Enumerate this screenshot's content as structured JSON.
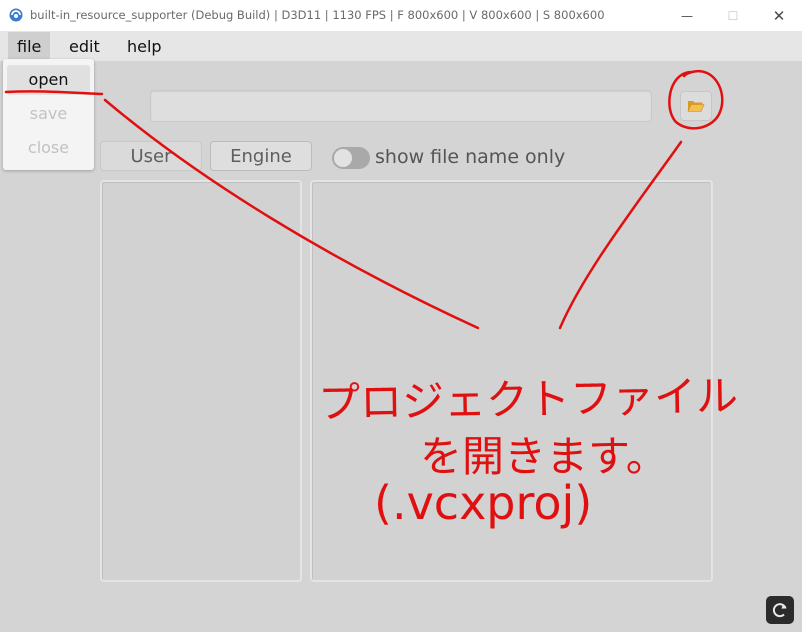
{
  "window": {
    "title": "built-in_resource_supporter (Debug Build) | D3D11 | 1130 FPS | F 800x600 | V 800x600 | S 800x600",
    "minimize_glyph": "—",
    "maximize_glyph": "☐",
    "close_glyph": "✕"
  },
  "menu": {
    "items": [
      {
        "label": "file"
      },
      {
        "label": "edit"
      },
      {
        "label": "help"
      }
    ],
    "file_dropdown": [
      {
        "label": "open",
        "enabled": true
      },
      {
        "label": "save",
        "enabled": false
      },
      {
        "label": "close",
        "enabled": false
      }
    ]
  },
  "path_field": {
    "value": ""
  },
  "folder_button": {
    "icon": "folder-open-icon"
  },
  "tabs": [
    {
      "label": "User"
    },
    {
      "label": "Engine"
    }
  ],
  "toggle": {
    "label": "show file name only",
    "on": false
  },
  "annotation": {
    "color": "#e01010",
    "line1": "プロジェクトファイル",
    "line2": "を開きます。",
    "line3": "(.vcxproj)"
  },
  "corner_button": {
    "icon": "refresh-icon"
  }
}
